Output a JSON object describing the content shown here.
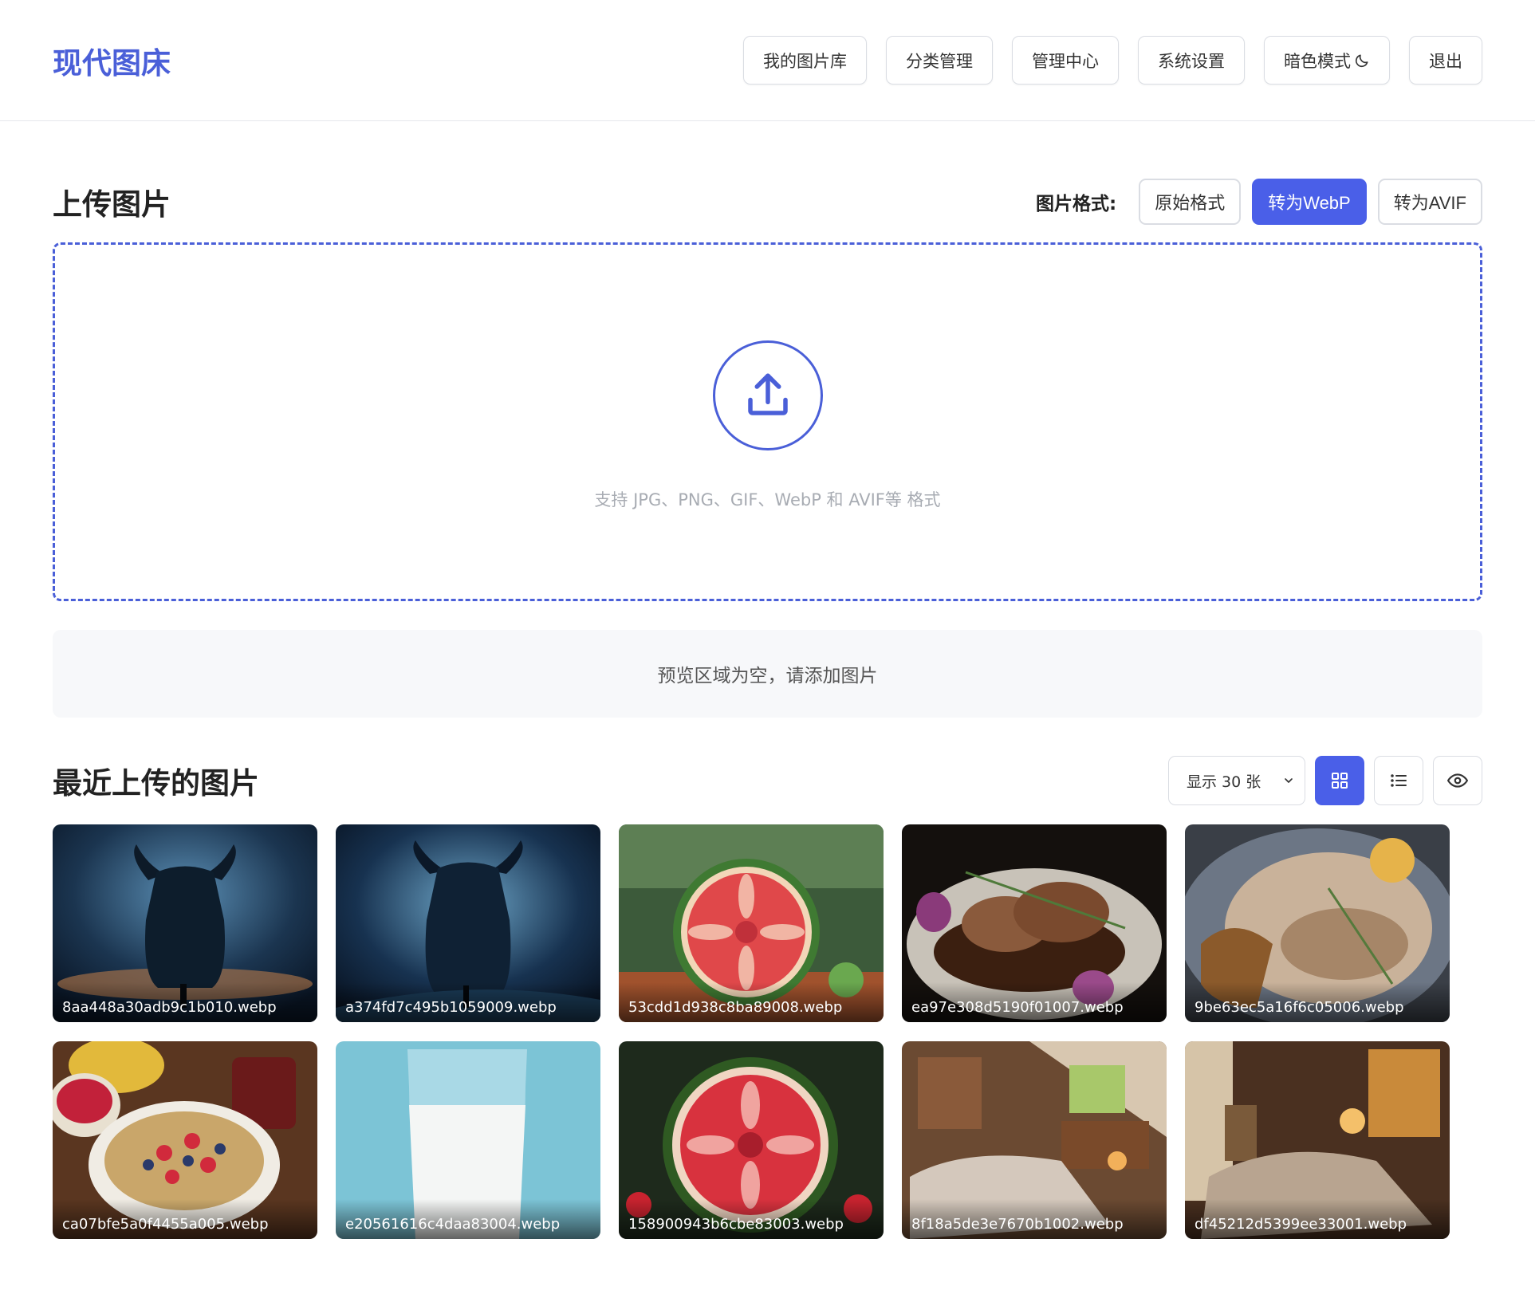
{
  "header": {
    "logo": "现代图床",
    "nav": [
      {
        "label": "我的图片库"
      },
      {
        "label": "分类管理"
      },
      {
        "label": "管理中心"
      },
      {
        "label": "系统设置"
      },
      {
        "label": "暗色模式"
      },
      {
        "label": "退出"
      }
    ]
  },
  "upload": {
    "title": "上传图片",
    "format_label": "图片格式:",
    "formats": [
      {
        "label": "原始格式",
        "active": false
      },
      {
        "label": "转为WebP",
        "active": true
      },
      {
        "label": "转为AVIF",
        "active": false
      }
    ],
    "hint": "支持 JPG、PNG、GIF、WebP 和 AVIF等 格式"
  },
  "preview": {
    "empty_text": "预览区域为空，请添加图片"
  },
  "recent": {
    "title": "最近上传的图片",
    "display_select": "显示 30 张",
    "view_mode": "grid",
    "images": [
      {
        "name": "8aa448a30adb9c1b010.webp",
        "theme": "bull"
      },
      {
        "name": "a374fd7c495b1059009.webp",
        "theme": "bull"
      },
      {
        "name": "53cdd1d938c8ba89008.webp",
        "theme": "watermelon-garden"
      },
      {
        "name": "ea97e308d5190f01007.webp",
        "theme": "steak"
      },
      {
        "name": "9be63ec5a16f6c05006.webp",
        "theme": "chicken-plate"
      },
      {
        "name": "ca07bfe5a0f4455a005.webp",
        "theme": "oatmeal"
      },
      {
        "name": "e20561616c4daa83004.webp",
        "theme": "milk"
      },
      {
        "name": "158900943b6cbe83003.webp",
        "theme": "watermelon-dark"
      },
      {
        "name": "8f18a5de3e7670b1002.webp",
        "theme": "bedroom"
      },
      {
        "name": "df45212d5399ee33001.webp",
        "theme": "bedroom-warm"
      }
    ]
  },
  "colors": {
    "accent": "#4a5fe8",
    "border": "#dadde3"
  }
}
